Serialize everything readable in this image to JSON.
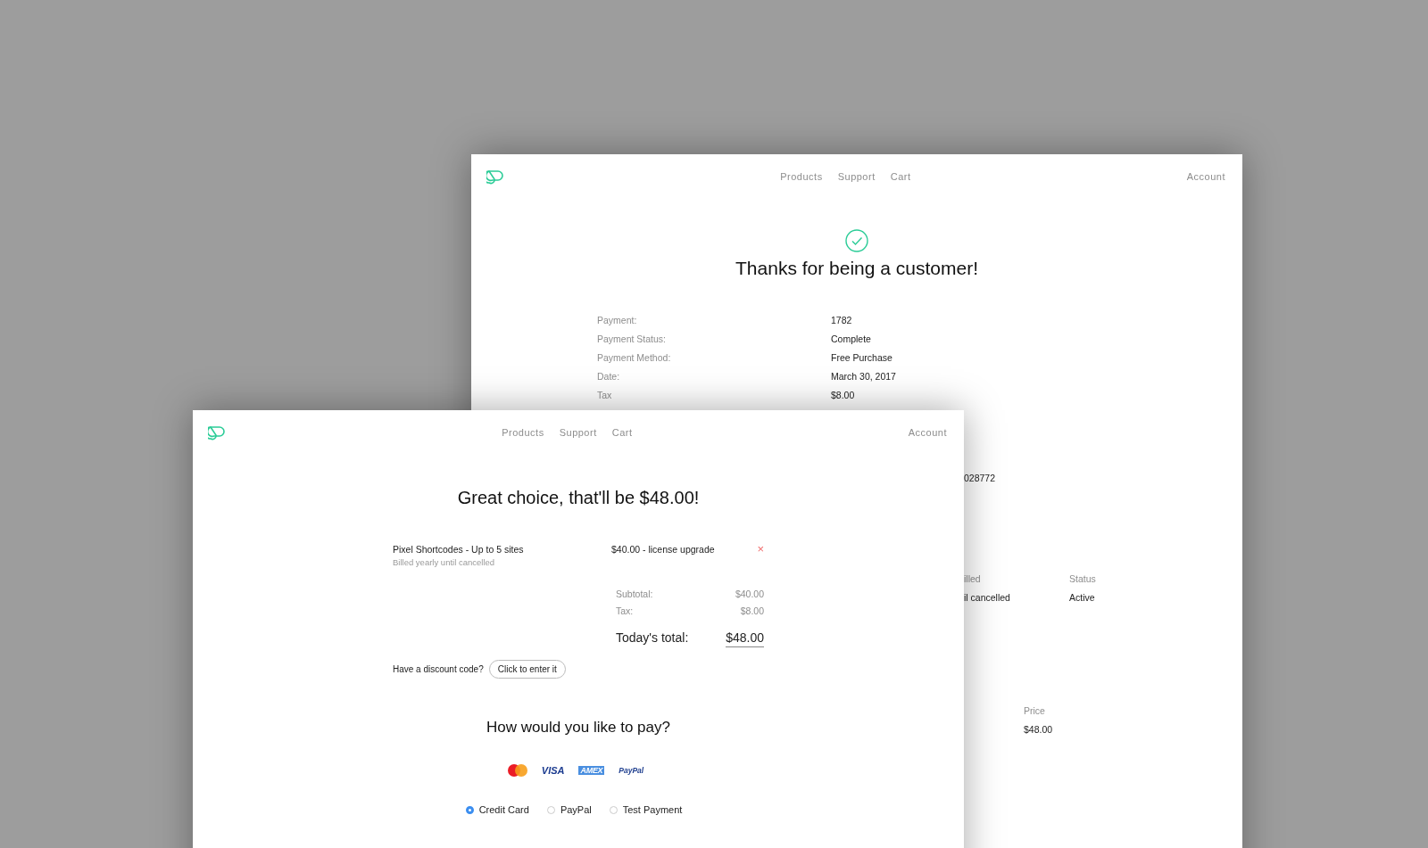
{
  "back_page": {
    "nav": [
      "Products",
      "Support",
      "Cart"
    ],
    "account": "Account",
    "title": "Thanks for being a customer!",
    "details": [
      {
        "label": "Payment:",
        "value": "1782"
      },
      {
        "label": "Payment Status:",
        "value": "Complete"
      },
      {
        "label": "Payment Method:",
        "value": "Free Purchase"
      },
      {
        "label": "Date:",
        "value": "March 30, 2017"
      },
      {
        "label": "Tax",
        "value": "$8.00"
      }
    ],
    "key_fragment": "028772",
    "subscription": {
      "columns": [
        "illed",
        "Status"
      ],
      "row": [
        "il cancelled",
        "Active"
      ]
    },
    "price": {
      "column": "Price",
      "value": "$48.00"
    }
  },
  "front_page": {
    "nav": [
      "Products",
      "Support",
      "Cart"
    ],
    "account": "Account",
    "title": "Great choice, that'll be $48.00!",
    "item": {
      "name": "Pixel Shortcodes - Up to 5 sites",
      "billing": "Billed yearly until cancelled",
      "price": "$40.00 - license upgrade",
      "remove": "×"
    },
    "totals": [
      {
        "label": "Subtotal:",
        "value": "$40.00"
      },
      {
        "label": "Tax:",
        "value": "$8.00"
      }
    ],
    "total": {
      "label": "Today's total:",
      "value": "$48.00"
    },
    "discount": {
      "prompt": "Have a discount code?",
      "button": "Click to enter it"
    },
    "pay_title": "How would you like to pay?",
    "card_logos": [
      {
        "kind": "mastercard"
      },
      {
        "kind": "visa",
        "label": "VISA"
      },
      {
        "kind": "amex",
        "label": "AMEX"
      },
      {
        "kind": "paypal",
        "label": "PayPal"
      }
    ],
    "payment_options": [
      {
        "label": "Credit Card",
        "selected": true
      },
      {
        "label": "PayPal",
        "selected": false
      },
      {
        "label": "Test Payment",
        "selected": false
      }
    ]
  }
}
